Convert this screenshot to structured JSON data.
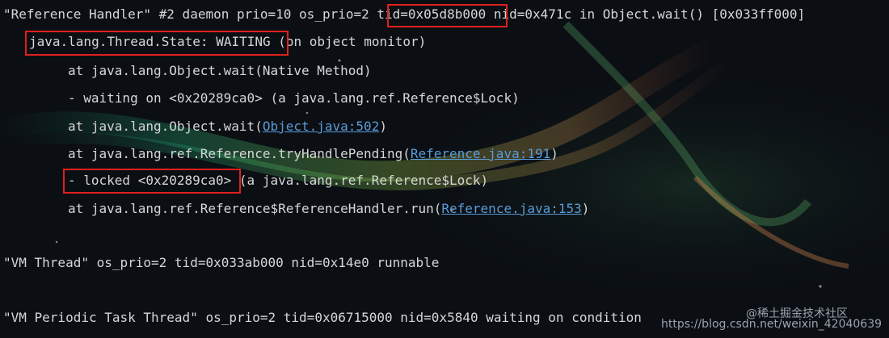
{
  "lines": [
    "\"Reference Handler\" #2 daemon prio=10 os_prio=2 tid=0x05d8b000 nid=0x471c in Object.wait() [0x033ff000]",
    "java.lang.Thread.State: WAITING (on object monitor)",
    "at java.lang.Object.wait(Native Method)",
    "- waiting on <0x20289ca0> (a java.lang.ref.Reference$Lock)",
    {
      "pre": "at java.lang.Object.wait(",
      "link": "Object.java:502",
      "post": ")"
    },
    {
      "pre": "at java.lang.ref.Reference.tryHandlePending(",
      "link": "Reference.java:191",
      "post": ")"
    },
    "- locked <0x20289ca0> (a java.lang.ref.Reference$Lock)",
    {
      "pre": "at java.lang.ref.Reference$ReferenceHandler.run(",
      "link": "Reference.java:153",
      "post": ")"
    },
    "\"VM Thread\" os_prio=2 tid=0x033ab000 nid=0x14e0 runnable",
    "\"VM Periodic Task Thread\" os_prio=2 tid=0x06715000 nid=0x5840 waiting on condition"
  ],
  "watermark": {
    "top": "@稀土掘金技术社区",
    "bottom": "https://blog.csdn.net/weixin_42040639"
  },
  "colors": {
    "text": "#d6d6d6",
    "link": "#5a9bd8",
    "highlight_box": "#e0201c",
    "background": "#0b0f14"
  }
}
